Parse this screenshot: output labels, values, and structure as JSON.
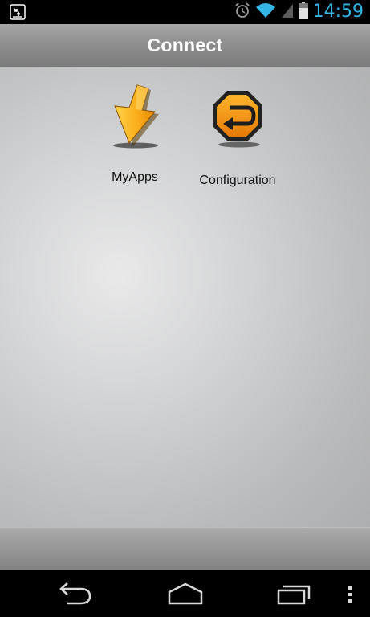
{
  "status_bar": {
    "time": "14:59",
    "left_icon": "download-notification-icon",
    "icons": [
      "alarm-icon",
      "wifi-icon",
      "signal-icon",
      "battery-icon"
    ],
    "accent_color": "#33b5e5"
  },
  "header": {
    "title": "Connect"
  },
  "apps": [
    {
      "label": "MyApps",
      "icon": "download-arrow-icon",
      "color": "#f7a81b"
    },
    {
      "label": "Configuration",
      "icon": "return-arrow-icon",
      "color": "#f39c12"
    }
  ],
  "nav_bar": {
    "buttons": [
      "back-icon",
      "home-icon",
      "recents-icon",
      "overflow-menu-icon"
    ]
  }
}
